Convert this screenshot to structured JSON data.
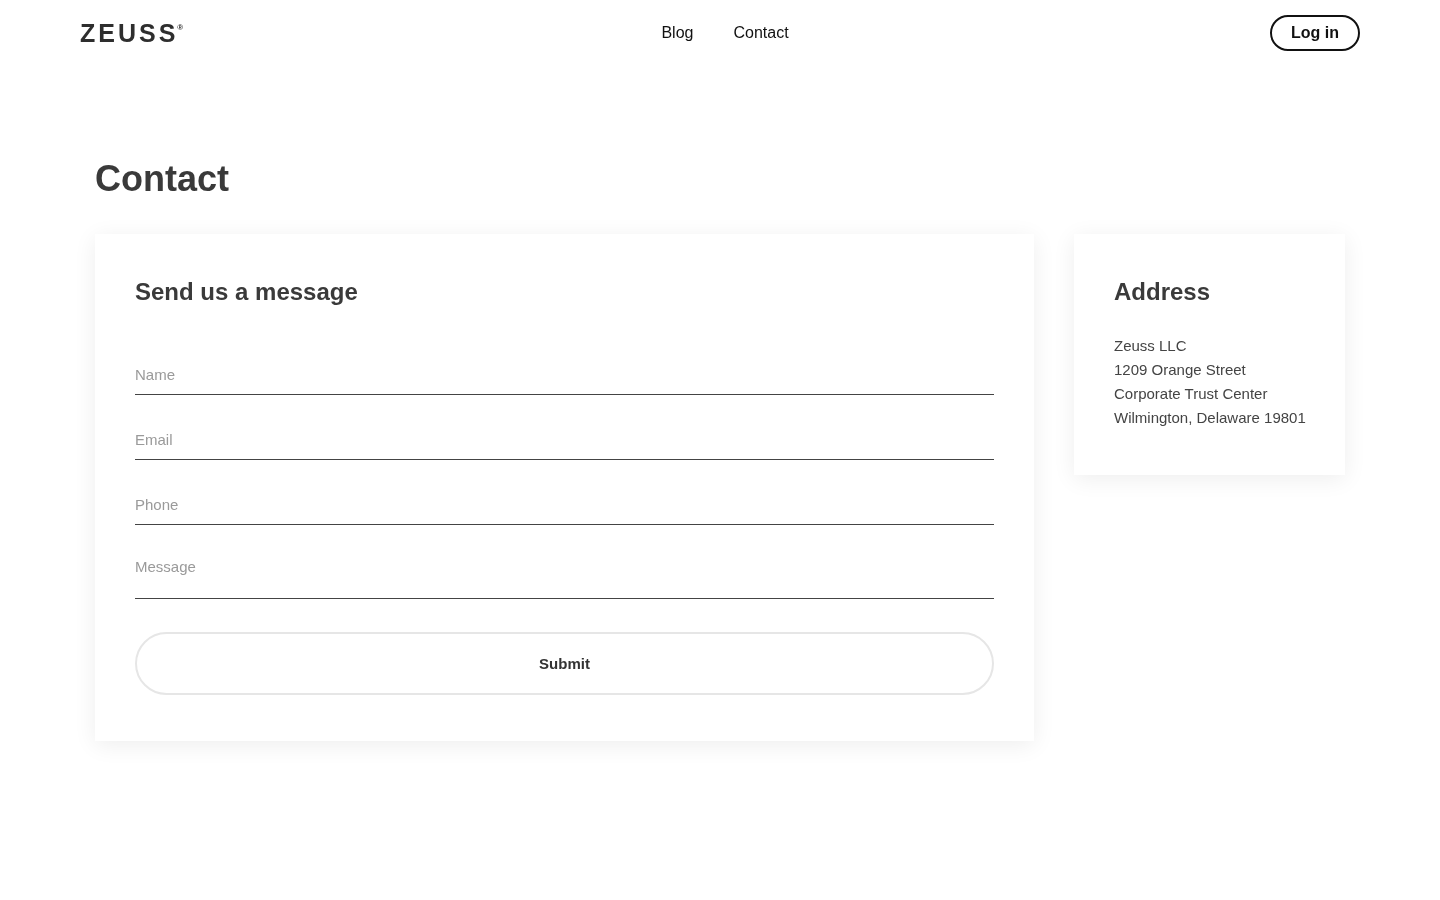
{
  "header": {
    "logo": "ZEUSS$^{®}$",
    "nav": [
      {
        "label": "Blog"
      },
      {
        "label": "Contact"
      }
    ],
    "login_button": "Log in"
  },
  "page_title": "Contact",
  "form": {
    "title": "Send us a message",
    "fields": [
      {
        "kind": "text",
        "placeholder": "Name"
      },
      {
        "kind": "text",
        "placeholder": "Email"
      },
      {
        "kind": "text",
        "placeholder": "Phone"
      },
      {
        "kind": "textarea",
        "placeholder": "Message"
      }
    ],
    "submit": "Submit"
  },
  "address": {
    "title": "Address",
    "lines": [
      "Zeuss LLC",
      "1209 Orange Street",
      "Corporate Trust Center",
      "Wilmington, Delaware 19801"
    ]
  }
}
